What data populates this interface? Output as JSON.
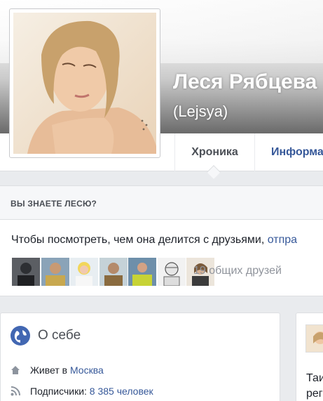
{
  "profile": {
    "name": "Леся Рябцева",
    "alt_name": "(Lejsya)"
  },
  "tabs": {
    "timeline": "Хроника",
    "info": "Информа"
  },
  "know": {
    "title": "ВЫ ЗНАЕТЕ ЛЕСЮ?",
    "text": "Чтобы посмотреть, чем она делится с друзьями, ",
    "link": "отпра",
    "mutual_friends": "19 общих друзей"
  },
  "about": {
    "title": "О себе",
    "lives_label": "Живет в ",
    "lives_value": "Москва",
    "followers_label": "Подписчики: ",
    "followers_value": "8 385 человек"
  },
  "post": {
    "text_line1": "Таи",
    "text_line2": "рег"
  },
  "colors": {
    "link": "#365899",
    "accent_icon": "#4267b2"
  },
  "icons": {
    "about": "globe-icon",
    "lives": "home-icon",
    "followers": "rss-icon"
  }
}
